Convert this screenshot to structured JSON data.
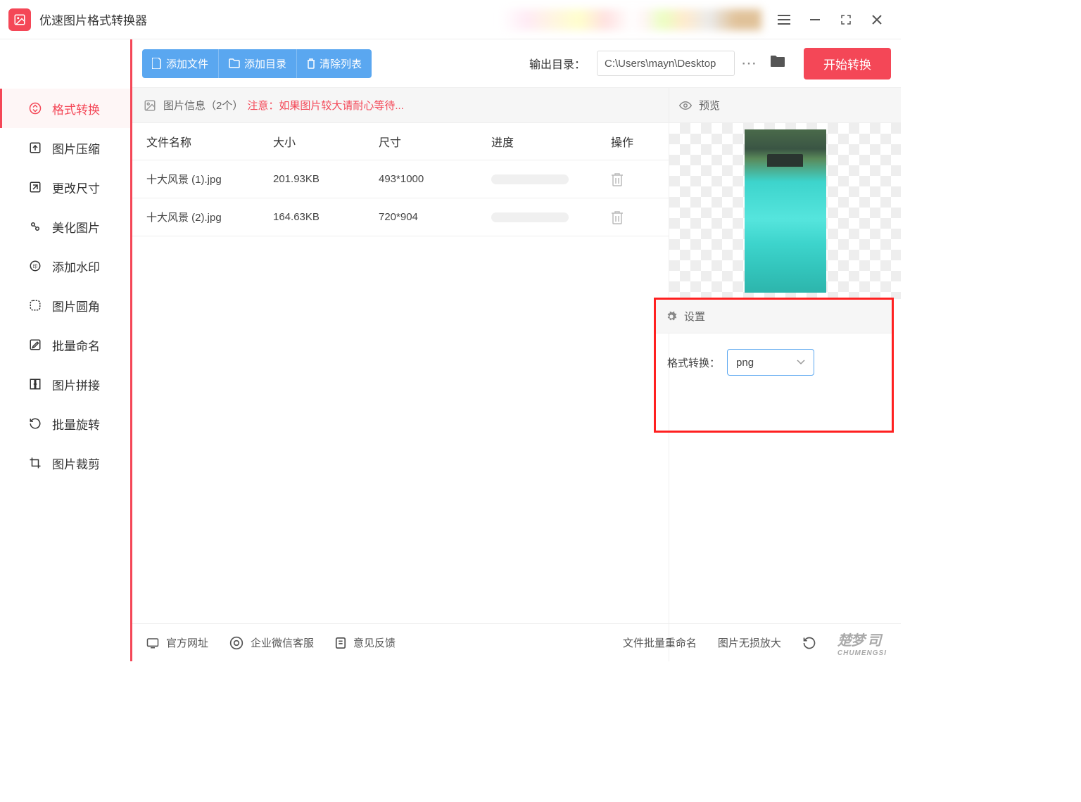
{
  "app": {
    "title": "优速图片格式转换器"
  },
  "toolbar": {
    "add_file": "添加文件",
    "add_folder": "添加目录",
    "clear_list": "清除列表",
    "output_dir_label": "输出目录：",
    "output_dir_value": "C:\\Users\\mayn\\Desktop",
    "start": "开始转换"
  },
  "sidebar": {
    "items": [
      {
        "label": "格式转换",
        "icon": "swap"
      },
      {
        "label": "图片压缩",
        "icon": "compress"
      },
      {
        "label": "更改尺寸",
        "icon": "resize"
      },
      {
        "label": "美化图片",
        "icon": "beautify"
      },
      {
        "label": "添加水印",
        "icon": "watermark"
      },
      {
        "label": "图片圆角",
        "icon": "corner"
      },
      {
        "label": "批量命名",
        "icon": "rename"
      },
      {
        "label": "图片拼接",
        "icon": "stitch"
      },
      {
        "label": "批量旋转",
        "icon": "rotate"
      },
      {
        "label": "图片裁剪",
        "icon": "crop"
      }
    ]
  },
  "info": {
    "label": "图片信息（2个）",
    "warning": "注意：如果图片较大请耐心等待..."
  },
  "table": {
    "headers": {
      "name": "文件名称",
      "size": "大小",
      "dim": "尺寸",
      "progress": "进度",
      "op": "操作"
    },
    "rows": [
      {
        "name": "十大风景 (1).jpg",
        "size": "201.93KB",
        "dim": "493*1000"
      },
      {
        "name": "十大风景 (2).jpg",
        "size": "164.63KB",
        "dim": "720*904"
      }
    ]
  },
  "preview": {
    "label": "预览"
  },
  "settings": {
    "label": "设置",
    "format_label": "格式转换：",
    "format_value": "png"
  },
  "footer": {
    "official_site": "官方网址",
    "wechat_support": "企业微信客服",
    "feedback": "意见反馈",
    "batch_rename": "文件批量重命名",
    "lossless_zoom": "图片无损放大",
    "watermark_brand": "楚梦",
    "watermark_sub": "CHUMENGSI"
  }
}
